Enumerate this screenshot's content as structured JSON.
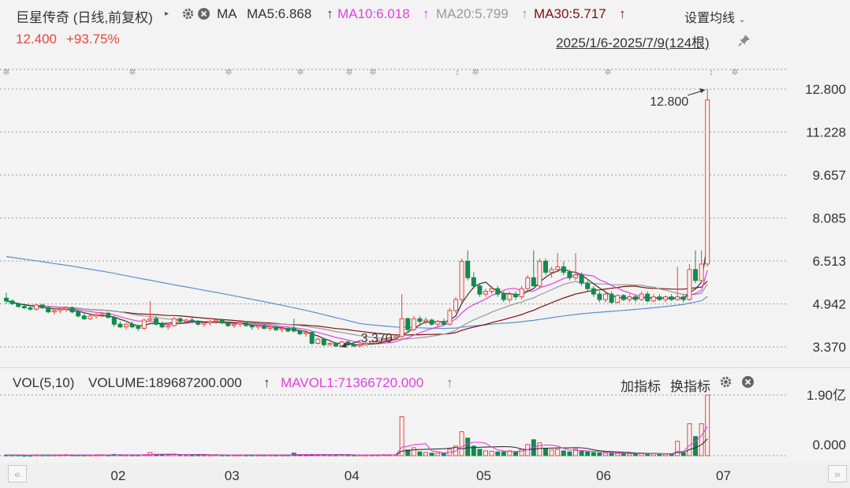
{
  "header": {
    "stock_name": "巨星传奇 (日线,前复权)",
    "play_icon": "triangle-right-icon",
    "ma_label": "MA",
    "ma5": "MA5:6.868",
    "ma10": "MA10:6.018",
    "ma20": "MA20:5.799",
    "ma30": "MA30:5.717",
    "up_arrow": "↑",
    "settings_label": "设置均线",
    "price": "12.400",
    "change": "+93.75%",
    "date_range": "2025/1/6-2025/7/9(124根)"
  },
  "volume_header": {
    "label": "VOL(5,10)",
    "volume": "VOLUME:189687200.000",
    "mavol1": "MAVOL1:71366720.000",
    "up_arrow": "↑",
    "add_indicator": "加指标",
    "switch_indicator": "换指标"
  },
  "colors": {
    "up": "#e8453c",
    "down": "#138a4e",
    "ma5": "#333333",
    "ma10": "#e040e0",
    "ma20": "#999999",
    "ma30": "#7a1010",
    "ma60": "#5b8fd0",
    "grid": "#999999"
  },
  "chart_data": {
    "type": "candlestick",
    "title": "巨星传奇 (日线,前复权)",
    "x_ticks": [
      "02",
      "03",
      "04",
      "05",
      "06",
      "07"
    ],
    "y_ticks": [
      "12.800",
      "11.228",
      "9.657",
      "8.085",
      "6.513",
      "4.942",
      "3.370"
    ],
    "ylim": [
      3.37,
      12.8
    ],
    "annotations": {
      "high": "12.800",
      "low": "3.370"
    },
    "volume_ticks": [
      "1.90亿",
      "0.000"
    ],
    "volume_max_yi": 1.9,
    "ohlc": [
      [
        5.15,
        5.35,
        4.95,
        5.05
      ],
      [
        5.05,
        5.1,
        4.9,
        4.95
      ],
      [
        4.95,
        5.0,
        4.8,
        4.85
      ],
      [
        4.85,
        4.95,
        4.75,
        4.8
      ],
      [
        4.8,
        4.9,
        4.7,
        4.75
      ],
      [
        4.75,
        4.95,
        4.7,
        4.9
      ],
      [
        4.9,
        4.95,
        4.75,
        4.8
      ],
      [
        4.8,
        4.85,
        4.6,
        4.65
      ],
      [
        4.65,
        4.75,
        4.55,
        4.7
      ],
      [
        4.7,
        4.8,
        4.6,
        4.75
      ],
      [
        4.75,
        4.85,
        4.65,
        4.8
      ],
      [
        4.8,
        4.85,
        4.6,
        4.65
      ],
      [
        4.65,
        4.7,
        4.45,
        4.5
      ],
      [
        4.5,
        4.6,
        4.35,
        4.4
      ],
      [
        4.4,
        4.55,
        4.35,
        4.5
      ],
      [
        4.5,
        4.6,
        4.4,
        4.55
      ],
      [
        4.55,
        4.65,
        4.45,
        4.6
      ],
      [
        4.6,
        4.65,
        4.4,
        4.45
      ],
      [
        4.45,
        4.5,
        4.1,
        4.2
      ],
      [
        4.2,
        4.3,
        4.05,
        4.1
      ],
      [
        4.1,
        4.25,
        4.0,
        4.2
      ],
      [
        4.2,
        4.3,
        4.05,
        4.1
      ],
      [
        4.1,
        4.2,
        3.95,
        4.05
      ],
      [
        4.05,
        4.4,
        4.0,
        4.35
      ],
      [
        4.35,
        5.05,
        4.3,
        4.4
      ],
      [
        4.4,
        4.5,
        4.15,
        4.2
      ],
      [
        4.2,
        4.3,
        4.05,
        4.1
      ],
      [
        4.1,
        4.2,
        4.0,
        4.15
      ],
      [
        4.15,
        4.45,
        4.1,
        4.4
      ],
      [
        4.4,
        4.45,
        4.25,
        4.3
      ],
      [
        4.3,
        4.4,
        4.2,
        4.35
      ],
      [
        4.35,
        4.45,
        4.25,
        4.3
      ],
      [
        4.3,
        4.35,
        4.15,
        4.2
      ],
      [
        4.2,
        4.3,
        4.1,
        4.25
      ],
      [
        4.25,
        4.35,
        4.15,
        4.3
      ],
      [
        4.3,
        4.4,
        4.2,
        4.35
      ],
      [
        4.35,
        4.4,
        4.2,
        4.25
      ],
      [
        4.25,
        4.3,
        4.1,
        4.15
      ],
      [
        4.15,
        4.25,
        4.05,
        4.2
      ],
      [
        4.2,
        4.3,
        4.1,
        4.25
      ],
      [
        4.25,
        4.3,
        4.1,
        4.15
      ],
      [
        4.15,
        4.2,
        4.0,
        4.1
      ],
      [
        4.1,
        4.2,
        4.0,
        4.15
      ],
      [
        4.15,
        4.2,
        4.0,
        4.05
      ],
      [
        4.05,
        4.15,
        3.95,
        4.1
      ],
      [
        4.1,
        4.15,
        3.95,
        4.0
      ],
      [
        4.0,
        4.1,
        3.9,
        4.05
      ],
      [
        4.05,
        4.1,
        3.9,
        3.95
      ],
      [
        4.05,
        4.4,
        3.9,
        3.95
      ],
      [
        3.95,
        4.0,
        3.8,
        3.85
      ],
      [
        3.85,
        3.95,
        3.75,
        3.9
      ],
      [
        3.9,
        3.95,
        3.45,
        3.5
      ],
      [
        3.5,
        3.7,
        3.45,
        3.65
      ],
      [
        3.65,
        3.7,
        3.4,
        3.45
      ],
      [
        3.45,
        3.55,
        3.4,
        3.5
      ],
      [
        3.5,
        3.55,
        3.38,
        3.4
      ],
      [
        3.4,
        3.6,
        3.37,
        3.55
      ],
      [
        3.55,
        3.6,
        3.4,
        3.45
      ],
      [
        3.45,
        3.5,
        3.37,
        3.4
      ],
      [
        3.4,
        3.5,
        3.37,
        3.45
      ],
      [
        3.45,
        3.55,
        3.4,
        3.5
      ],
      [
        3.5,
        3.6,
        3.45,
        3.55
      ],
      [
        3.55,
        3.65,
        3.5,
        3.6
      ],
      [
        3.6,
        3.7,
        3.55,
        3.65
      ],
      [
        3.65,
        3.75,
        3.6,
        3.7
      ],
      [
        3.7,
        3.8,
        3.65,
        3.75
      ],
      [
        3.75,
        5.3,
        3.7,
        4.4
      ],
      [
        4.4,
        4.45,
        3.9,
        4.0
      ],
      [
        4.0,
        4.5,
        3.95,
        4.4
      ],
      [
        4.4,
        4.5,
        4.2,
        4.3
      ],
      [
        4.3,
        4.45,
        4.2,
        4.35
      ],
      [
        4.35,
        4.4,
        4.15,
        4.2
      ],
      [
        4.2,
        4.35,
        4.1,
        4.3
      ],
      [
        4.3,
        4.4,
        4.15,
        4.2
      ],
      [
        4.2,
        4.8,
        4.15,
        4.7
      ],
      [
        4.7,
        5.2,
        4.6,
        5.1
      ],
      [
        5.1,
        6.6,
        5.0,
        6.5
      ],
      [
        6.5,
        6.9,
        5.8,
        5.9
      ],
      [
        5.9,
        6.1,
        5.5,
        5.6
      ],
      [
        5.6,
        5.7,
        5.2,
        5.3
      ],
      [
        5.3,
        5.5,
        5.2,
        5.4
      ],
      [
        5.4,
        5.6,
        5.3,
        5.5
      ],
      [
        5.5,
        5.6,
        5.2,
        5.3
      ],
      [
        5.3,
        5.4,
        5.0,
        5.1
      ],
      [
        5.1,
        5.4,
        5.0,
        5.3
      ],
      [
        5.3,
        5.4,
        5.1,
        5.2
      ],
      [
        5.2,
        5.6,
        5.1,
        5.5
      ],
      [
        5.5,
        6.0,
        5.4,
        5.9
      ],
      [
        5.9,
        6.9,
        5.8,
        5.6
      ],
      [
        5.6,
        6.6,
        5.5,
        6.5
      ],
      [
        6.5,
        6.6,
        6.0,
        6.1
      ],
      [
        6.1,
        6.3,
        5.9,
        6.2
      ],
      [
        6.2,
        6.8,
        6.1,
        6.3
      ],
      [
        6.3,
        6.5,
        6.0,
        6.1
      ],
      [
        6.1,
        6.2,
        5.8,
        5.9
      ],
      [
        5.9,
        6.8,
        5.8,
        6.0
      ],
      [
        6.0,
        6.1,
        5.6,
        5.7
      ],
      [
        5.7,
        5.8,
        5.4,
        5.5
      ],
      [
        5.5,
        5.6,
        5.2,
        5.3
      ],
      [
        5.3,
        5.4,
        5.0,
        5.1
      ],
      [
        5.1,
        5.4,
        5.0,
        5.3
      ],
      [
        5.3,
        5.4,
        4.95,
        5.0
      ],
      [
        5.0,
        5.3,
        4.95,
        5.25
      ],
      [
        5.25,
        5.3,
        5.05,
        5.1
      ],
      [
        5.1,
        5.3,
        5.0,
        5.2
      ],
      [
        5.2,
        5.3,
        5.0,
        5.1
      ],
      [
        5.1,
        5.4,
        5.05,
        5.3
      ],
      [
        5.3,
        5.4,
        5.0,
        5.05
      ],
      [
        5.05,
        5.3,
        5.0,
        5.2
      ],
      [
        5.2,
        5.3,
        5.05,
        5.1
      ],
      [
        5.1,
        5.25,
        5.0,
        5.2
      ],
      [
        5.2,
        5.3,
        5.05,
        5.1
      ],
      [
        5.1,
        6.3,
        5.05,
        5.2
      ],
      [
        5.2,
        5.3,
        5.0,
        5.1
      ],
      [
        5.1,
        6.4,
        5.05,
        6.2
      ],
      [
        6.2,
        6.9,
        5.7,
        5.8
      ],
      [
        5.8,
        6.9,
        5.7,
        6.4
      ],
      [
        6.4,
        12.8,
        6.3,
        12.4
      ]
    ],
    "volume_yi": [
      0.02,
      0.02,
      0.02,
      0.01,
      0.01,
      0.02,
      0.02,
      0.02,
      0.02,
      0.02,
      0.03,
      0.02,
      0.02,
      0.02,
      0.02,
      0.02,
      0.03,
      0.02,
      0.04,
      0.03,
      0.02,
      0.02,
      0.02,
      0.03,
      0.1,
      0.04,
      0.03,
      0.03,
      0.05,
      0.03,
      0.02,
      0.02,
      0.02,
      0.02,
      0.02,
      0.03,
      0.02,
      0.02,
      0.02,
      0.02,
      0.02,
      0.02,
      0.02,
      0.02,
      0.02,
      0.02,
      0.02,
      0.02,
      0.08,
      0.03,
      0.02,
      0.04,
      0.03,
      0.03,
      0.02,
      0.02,
      0.03,
      0.02,
      0.02,
      0.02,
      0.02,
      0.02,
      0.02,
      0.03,
      0.03,
      0.03,
      1.22,
      0.18,
      0.25,
      0.12,
      0.1,
      0.08,
      0.08,
      0.07,
      0.2,
      0.3,
      0.75,
      0.55,
      0.3,
      0.2,
      0.15,
      0.14,
      0.12,
      0.12,
      0.15,
      0.12,
      0.2,
      0.35,
      0.5,
      0.4,
      0.22,
      0.18,
      0.2,
      0.15,
      0.12,
      0.2,
      0.14,
      0.12,
      0.1,
      0.09,
      0.08,
      0.08,
      0.07,
      0.07,
      0.06,
      0.06,
      0.07,
      0.06,
      0.06,
      0.05,
      0.05,
      0.05,
      0.45,
      0.08,
      1.0,
      0.6,
      1.0,
      1.9
    ],
    "ma60_start": 6.7
  }
}
